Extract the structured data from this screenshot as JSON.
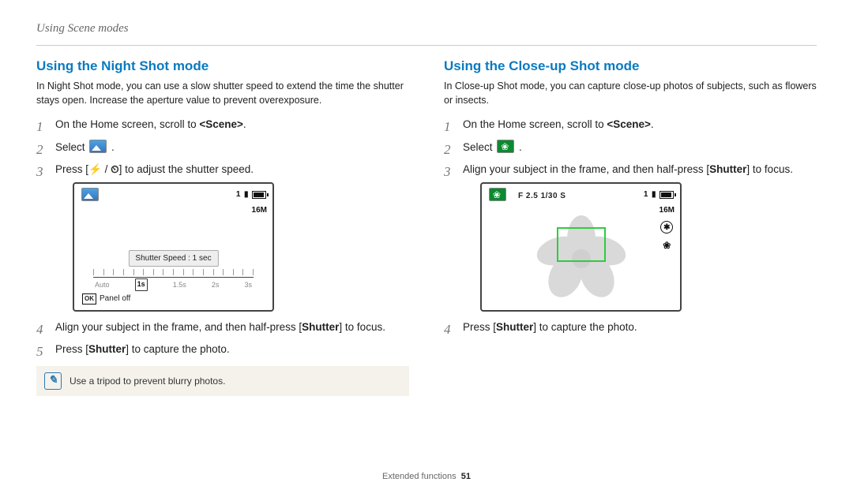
{
  "breadcrumb": "Using Scene modes",
  "left": {
    "heading": "Using the Night Shot mode",
    "intro": "In Night Shot mode, you can use a slow shutter speed to extend the time the shutter stays open. Increase the aperture value to prevent overexposure.",
    "step1_pre": "On the Home screen, scroll to ",
    "step1_bold": "<Scene>",
    "step1_post": ".",
    "step2": "Select ",
    "step2_post": " .",
    "step3_pre": "Press [",
    "step3_glyph1": "⚡",
    "step3_mid": " / ",
    "step3_glyph2": "⏲",
    "step3_post": "] to adjust the shutter speed.",
    "step4_pre": "Align your subject in the frame, and then half-press [",
    "step4_bold": "Shutter",
    "step4_post": "] to focus.",
    "step5_pre": "Press [",
    "step5_bold": "Shutter",
    "step5_post": "] to capture the photo.",
    "tip": "Use a tripod to prevent blurry photos.",
    "device": {
      "shutter_label": "Shutter Speed : 1 sec",
      "scale": [
        "Auto",
        "1s",
        "1.5s",
        "2s",
        "3s"
      ],
      "selected": "1s",
      "panel_off": "Panel off",
      "ok": "OK",
      "status_count": "1",
      "res": "16M"
    }
  },
  "right": {
    "heading": "Using the Close-up Shot mode",
    "intro": "In Close-up Shot mode, you can capture close-up photos of subjects, such as flowers or insects.",
    "step1_pre": "On the Home screen, scroll to ",
    "step1_bold": "<Scene>",
    "step1_post": ".",
    "step2": "Select ",
    "step2_post": " .",
    "step3_pre": "Align your subject in the frame, and then half-press [",
    "step3_bold": "Shutter",
    "step3_post": "] to focus.",
    "step4_pre": "Press [",
    "step4_bold": "Shutter",
    "step4_post": "] to capture the photo.",
    "device": {
      "top_text": "F 2.5  1/30 S",
      "status_count": "1",
      "res": "16M"
    }
  },
  "footer": {
    "label": "Extended functions",
    "page": "51"
  }
}
